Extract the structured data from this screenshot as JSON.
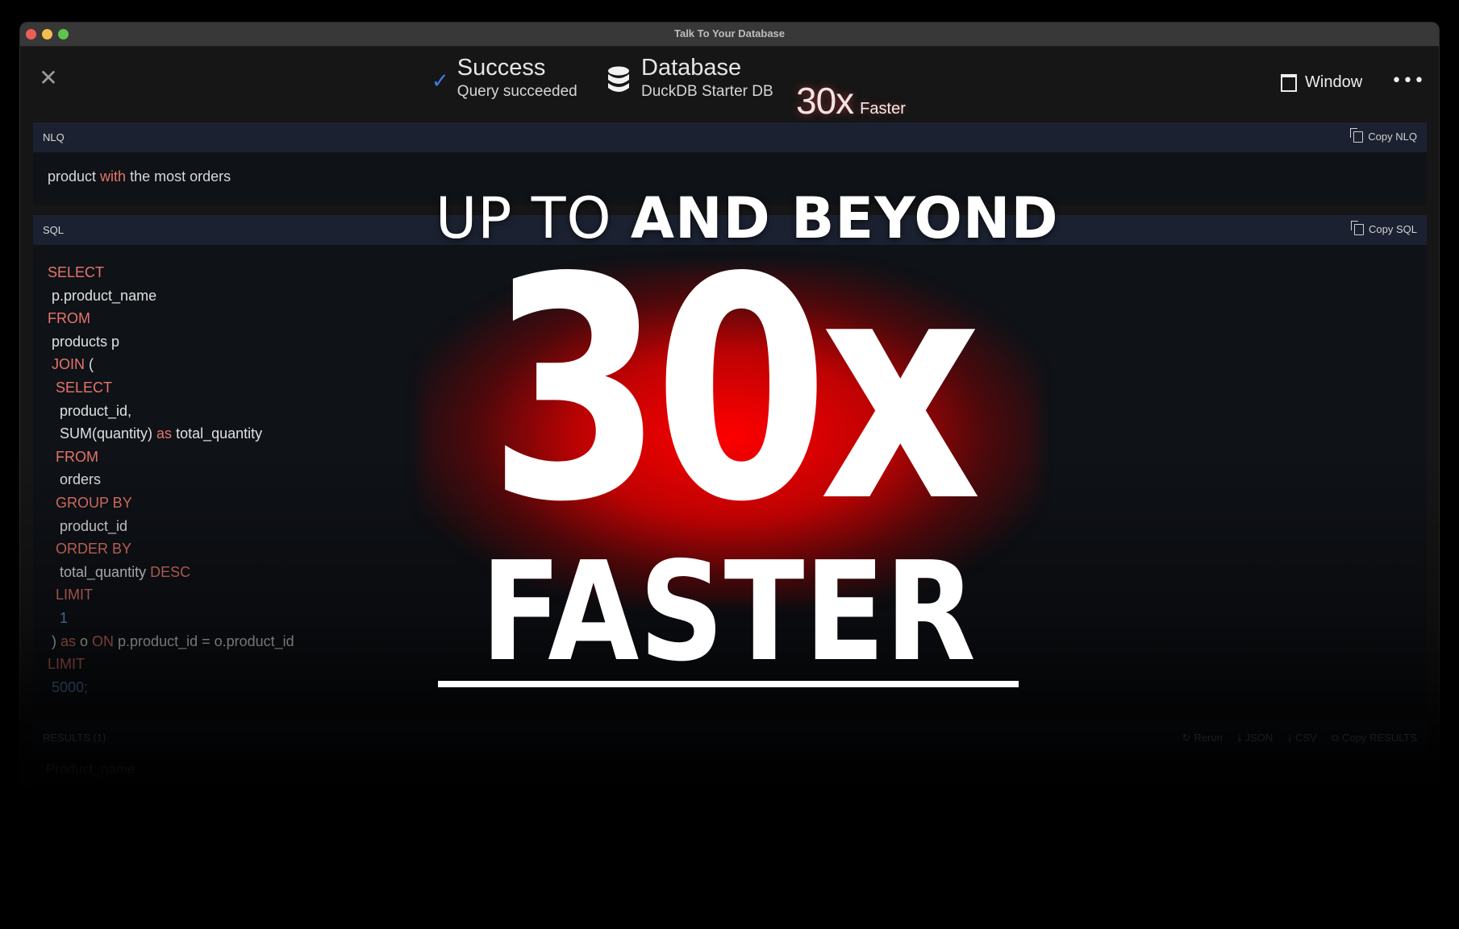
{
  "window": {
    "title": "Talk To Your Database",
    "controls": [
      "close",
      "minimize",
      "zoom"
    ]
  },
  "toolbar": {
    "close_icon": "close-icon",
    "status": {
      "icon": "checkmark-icon",
      "title": "Success",
      "subtitle": "Query succeeded",
      "icon_color": "#3e7ce8"
    },
    "database": {
      "icon": "database-icon",
      "title": "Database",
      "subtitle": "DuckDB Starter DB"
    },
    "speed": {
      "value": "30x",
      "label": "Faster"
    },
    "window_button": {
      "icon": "window-icon",
      "label": "Window"
    },
    "more_icon": "•••"
  },
  "nlq": {
    "label": "NLQ",
    "copy_label": "Copy NLQ",
    "text_parts": [
      {
        "text": "product ",
        "kw": false
      },
      {
        "text": "with",
        "kw": true
      },
      {
        "text": " the most orders",
        "kw": false
      }
    ]
  },
  "sql": {
    "label": "SQL",
    "copy_label": "Copy SQL",
    "lines": [
      [
        {
          "t": "SELECT",
          "c": "kw"
        }
      ],
      [
        {
          "t": " p.product_name",
          "c": "id"
        }
      ],
      [
        {
          "t": "FROM",
          "c": "kw"
        }
      ],
      [
        {
          "t": " products p",
          "c": "id"
        }
      ],
      [
        {
          "t": " JOIN",
          "c": "kw"
        },
        {
          "t": " (",
          "c": "id"
        }
      ],
      [
        {
          "t": "  SELECT",
          "c": "kw"
        }
      ],
      [
        {
          "t": "   product_id,",
          "c": "id"
        }
      ],
      [
        {
          "t": "   SUM(quantity) ",
          "c": "id"
        },
        {
          "t": "as",
          "c": "kw"
        },
        {
          "t": " total_quantity",
          "c": "id"
        }
      ],
      [
        {
          "t": "  FROM",
          "c": "kw"
        }
      ],
      [
        {
          "t": "   orders",
          "c": "id"
        }
      ],
      [
        {
          "t": "  GROUP BY",
          "c": "kw"
        }
      ],
      [
        {
          "t": "   product_id",
          "c": "id"
        }
      ],
      [
        {
          "t": "  ORDER BY",
          "c": "kw"
        }
      ],
      [
        {
          "t": "   total_quantity ",
          "c": "id"
        },
        {
          "t": "DESC",
          "c": "kw"
        }
      ],
      [
        {
          "t": "  LIMIT",
          "c": "kw"
        }
      ],
      [
        {
          "t": "   1",
          "c": "num"
        }
      ],
      [
        {
          "t": " ) ",
          "c": "id"
        },
        {
          "t": "as",
          "c": "kw"
        },
        {
          "t": " o ",
          "c": "id"
        },
        {
          "t": "ON",
          "c": "kw"
        },
        {
          "t": " p.product_id = o.product_id",
          "c": "id"
        }
      ],
      [
        {
          "t": "LIMIT",
          "c": "kw"
        }
      ],
      [
        {
          "t": " 5000;",
          "c": "num"
        }
      ]
    ]
  },
  "results": {
    "label": "RESULTS (1)",
    "actions": [
      {
        "icon": "refresh-icon",
        "glyph": "↻",
        "label": "Rerun"
      },
      {
        "icon": "download-icon",
        "glyph": "⤓",
        "label": "JSON"
      },
      {
        "icon": "download-icon",
        "glyph": "⤓",
        "label": "CSV"
      },
      {
        "icon": "copy-icon",
        "glyph": "⧉",
        "label": "Copy RESULTS"
      }
    ],
    "columns": [
      "Product_name"
    ]
  },
  "overlay": {
    "top_thin": "UP TO ",
    "top_bold": "AND BEYOND",
    "big": "30x",
    "faster": "FASTER",
    "glow_color": "#ff0000"
  }
}
